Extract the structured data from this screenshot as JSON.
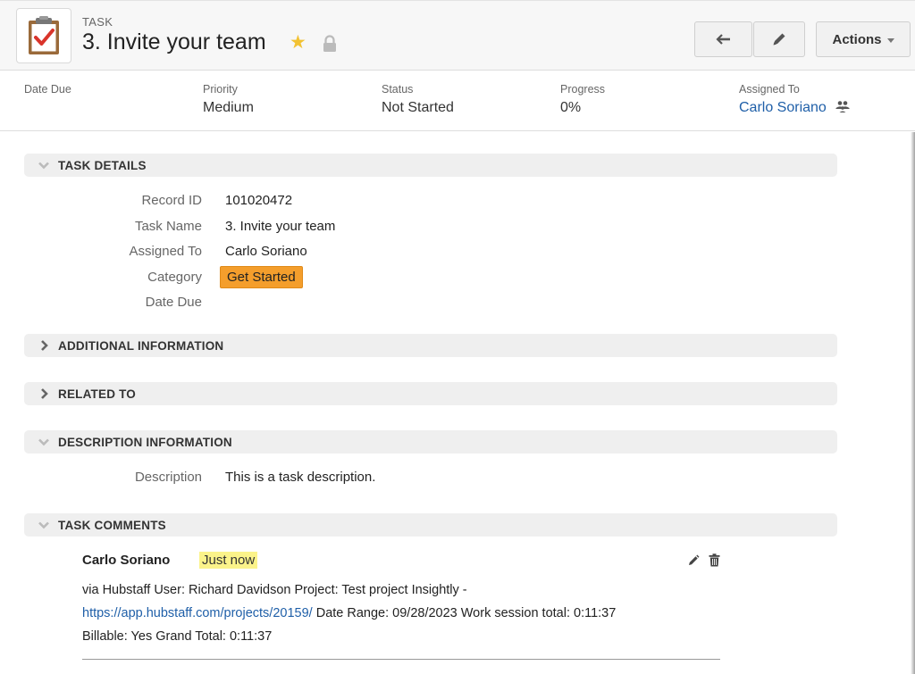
{
  "header": {
    "type_label": "TASK",
    "title": "3. Invite your team",
    "actions_label": "Actions"
  },
  "summary": {
    "date_due_label": "Date Due",
    "date_due_value": "",
    "priority_label": "Priority",
    "priority_value": "Medium",
    "status_label": "Status",
    "status_value": "Not Started",
    "progress_label": "Progress",
    "progress_value": "0%",
    "assigned_label": "Assigned To",
    "assigned_value": "Carlo Soriano"
  },
  "sections": {
    "task_details": "TASK DETAILS",
    "additional_information": "ADDITIONAL INFORMATION",
    "related_to": "RELATED TO",
    "description_information": "DESCRIPTION INFORMATION",
    "task_comments": "TASK COMMENTS"
  },
  "task_details": {
    "record_id_label": "Record ID",
    "record_id_value": "101020472",
    "task_name_label": "Task Name",
    "task_name_value": "3. Invite your team",
    "assigned_to_label": "Assigned To",
    "assigned_to_value": "Carlo Soriano",
    "category_label": "Category",
    "category_value": "Get Started",
    "date_due_label": "Date Due",
    "date_due_value": ""
  },
  "description": {
    "label": "Description",
    "value": "This is a task description."
  },
  "comment": {
    "author": "Carlo Soriano",
    "time": "Just now",
    "line1": "via Hubstaff User: Richard Davidson Project: Test project Insightly -",
    "link": "https://app.hubstaff.com/projects/20159/",
    "line2_rest": " Date Range: 09/28/2023 Work session total: 0:11:37",
    "line3": "Billable: Yes Grand Total: 0:11:37"
  },
  "colors": {
    "accent_link": "#1f5fa8",
    "category_badge": "#f49e2c",
    "star": "#f2c233",
    "highlight": "#fbf38a"
  },
  "icons": [
    "task-clipboard-icon",
    "star-icon",
    "lock-icon",
    "back-arrow-icon",
    "pencil-icon",
    "people-icon",
    "chevron-down-icon",
    "chevron-right-icon",
    "trash-icon"
  ]
}
